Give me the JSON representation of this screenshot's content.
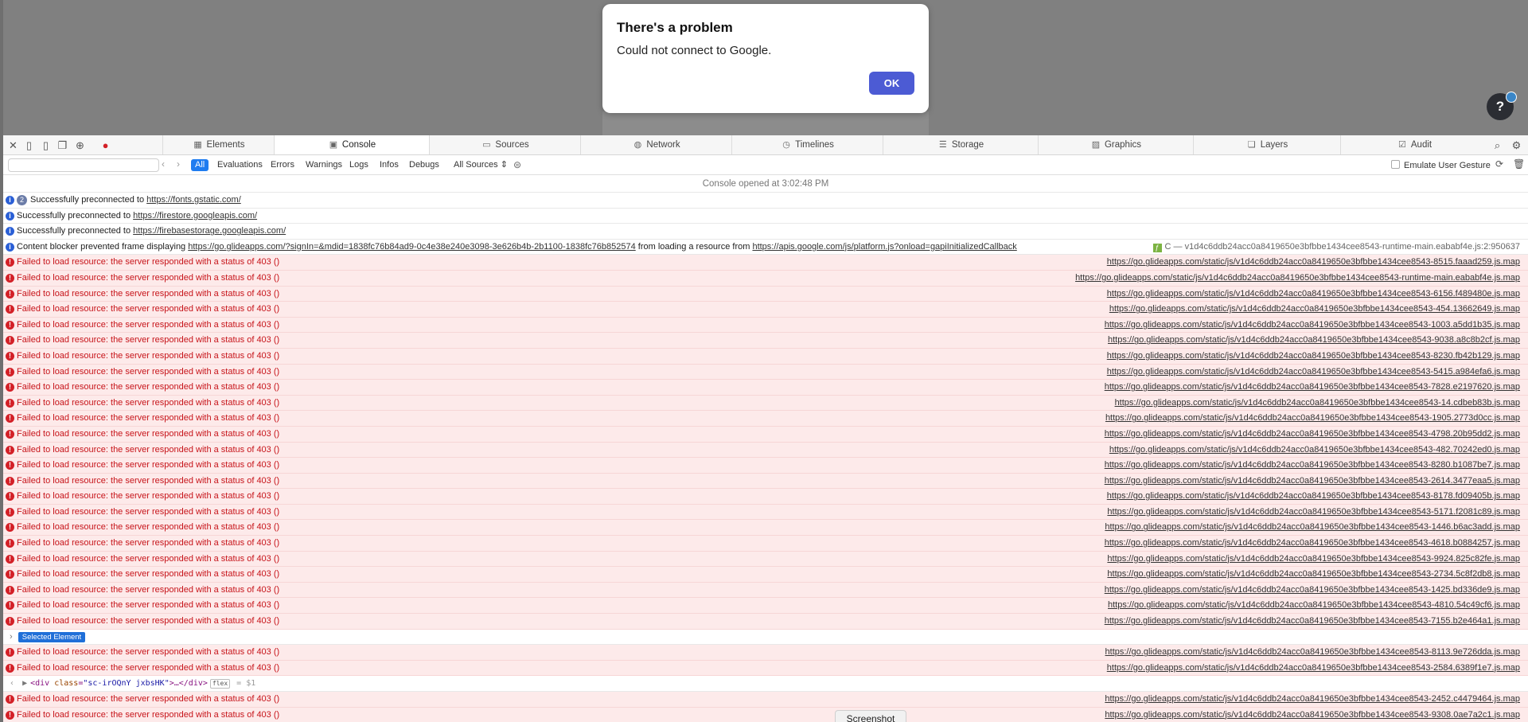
{
  "dialog": {
    "title": "There's a problem",
    "message": "Could not connect to Google.",
    "ok_label": "OK"
  },
  "help": {
    "label": "?"
  },
  "devtools": {
    "tabs": [
      "Elements",
      "Console",
      "Sources",
      "Network",
      "Timelines",
      "Storage",
      "Graphics",
      "Layers",
      "Audit"
    ],
    "active_tab": "Console",
    "filters": [
      "All",
      "Evaluations",
      "Errors",
      "Warnings",
      "Logs",
      "Infos",
      "Debugs"
    ],
    "active_filter": "All",
    "sources_label": "All Sources",
    "emulate_label": "Emulate User Gesture",
    "search_placeholder": ""
  },
  "console": {
    "opened_at": "Console opened at 3:02:48 PM",
    "info_rows": [
      {
        "count": "2",
        "text": "Successfully preconnected to ",
        "link": "https://fonts.gstatic.com/"
      },
      {
        "count": "",
        "text": "Successfully preconnected to ",
        "link": "https://firestore.googleapis.com/"
      },
      {
        "count": "",
        "text": "Successfully preconnected to ",
        "link": "https://firebasestorage.googleapis.com/"
      }
    ],
    "blocker": {
      "prefix": "Content blocker prevented frame displaying ",
      "frame_link": "https://go.glideapps.com/?signIn=&mdid=1838fc76b84ad9-0c4e38e240e3098-3e626b4b-2b1100-1838fc76b852574",
      "middle": " from loading a resource from ",
      "resource_link": "https://apis.google.com/js/platform.js?onload=gapiInitializedCallback",
      "source": "C — v1d4c6ddb24acc0a8419650e3bfbbe1434cee8543-runtime-main.eababf4e.js:2:950637"
    },
    "error_text": "Failed to load resource: the server responded with a status of 403 ()",
    "error_sources_a": [
      "https://go.glideapps.com/static/js/v1d4c6ddb24acc0a8419650e3bfbbe1434cee8543-8515.faaad259.js.map",
      "https://go.glideapps.com/static/js/v1d4c6ddb24acc0a8419650e3bfbbe1434cee8543-runtime-main.eababf4e.js.map",
      "https://go.glideapps.com/static/js/v1d4c6ddb24acc0a8419650e3bfbbe1434cee8543-6156.f489480e.js.map",
      "https://go.glideapps.com/static/js/v1d4c6ddb24acc0a8419650e3bfbbe1434cee8543-454.13662649.js.map",
      "https://go.glideapps.com/static/js/v1d4c6ddb24acc0a8419650e3bfbbe1434cee8543-1003.a5dd1b35.js.map",
      "https://go.glideapps.com/static/js/v1d4c6ddb24acc0a8419650e3bfbbe1434cee8543-9038.a8c8b2cf.js.map",
      "https://go.glideapps.com/static/js/v1d4c6ddb24acc0a8419650e3bfbbe1434cee8543-8230.fb42b129.js.map",
      "https://go.glideapps.com/static/js/v1d4c6ddb24acc0a8419650e3bfbbe1434cee8543-5415.a984efa6.js.map",
      "https://go.glideapps.com/static/js/v1d4c6ddb24acc0a8419650e3bfbbe1434cee8543-7828.e2197620.js.map",
      "https://go.glideapps.com/static/js/v1d4c6ddb24acc0a8419650e3bfbbe1434cee8543-14.cdbeb83b.js.map",
      "https://go.glideapps.com/static/js/v1d4c6ddb24acc0a8419650e3bfbbe1434cee8543-1905.2773d0cc.js.map",
      "https://go.glideapps.com/static/js/v1d4c6ddb24acc0a8419650e3bfbbe1434cee8543-4798.20b95dd2.js.map",
      "https://go.glideapps.com/static/js/v1d4c6ddb24acc0a8419650e3bfbbe1434cee8543-482.70242ed0.js.map",
      "https://go.glideapps.com/static/js/v1d4c6ddb24acc0a8419650e3bfbbe1434cee8543-8280.b1087be7.js.map",
      "https://go.glideapps.com/static/js/v1d4c6ddb24acc0a8419650e3bfbbe1434cee8543-2614.3477eaa5.js.map",
      "https://go.glideapps.com/static/js/v1d4c6ddb24acc0a8419650e3bfbbe1434cee8543-8178.fd09405b.js.map",
      "https://go.glideapps.com/static/js/v1d4c6ddb24acc0a8419650e3bfbbe1434cee8543-5171.f2081c89.js.map",
      "https://go.glideapps.com/static/js/v1d4c6ddb24acc0a8419650e3bfbbe1434cee8543-1446.b6ac3add.js.map",
      "https://go.glideapps.com/static/js/v1d4c6ddb24acc0a8419650e3bfbbe1434cee8543-4618.b0884257.js.map",
      "https://go.glideapps.com/static/js/v1d4c6ddb24acc0a8419650e3bfbbe1434cee8543-9924.825c82fe.js.map",
      "https://go.glideapps.com/static/js/v1d4c6ddb24acc0a8419650e3bfbbe1434cee8543-2734.5c8f2db8.js.map",
      "https://go.glideapps.com/static/js/v1d4c6ddb24acc0a8419650e3bfbbe1434cee8543-1425.bd336de9.js.map",
      "https://go.glideapps.com/static/js/v1d4c6ddb24acc0a8419650e3bfbbe1434cee8543-4810.54c49cf6.js.map",
      "https://go.glideapps.com/static/js/v1d4c6ddb24acc0a8419650e3bfbbe1434cee8543-7155.b2e464a1.js.map"
    ],
    "selected_label": "Selected Element",
    "error_sources_b": [
      "https://go.glideapps.com/static/js/v1d4c6ddb24acc0a8419650e3bfbbe1434cee8543-8113.9e726dda.js.map",
      "https://go.glideapps.com/static/js/v1d4c6ddb24acc0a8419650e3bfbbe1434cee8543-2584.6389f1e7.js.map"
    ],
    "dom": {
      "tag_open": "<div ",
      "attr": "class",
      "value": "\"sc-irOQnY jxbsHK\"",
      "tag_close": ">…</div>",
      "flex": "flex",
      "ref": "= $1"
    },
    "error_sources_c": [
      "https://go.glideapps.com/static/js/v1d4c6ddb24acc0a8419650e3bfbbe1434cee8543-2452.c4479464.js.map",
      "https://go.glideapps.com/static/js/v1d4c6ddb24acc0a8419650e3bfbbe1434cee8543-9308.0ae7a2c1.js.map"
    ]
  },
  "screenshot_tip": "Screenshot"
}
